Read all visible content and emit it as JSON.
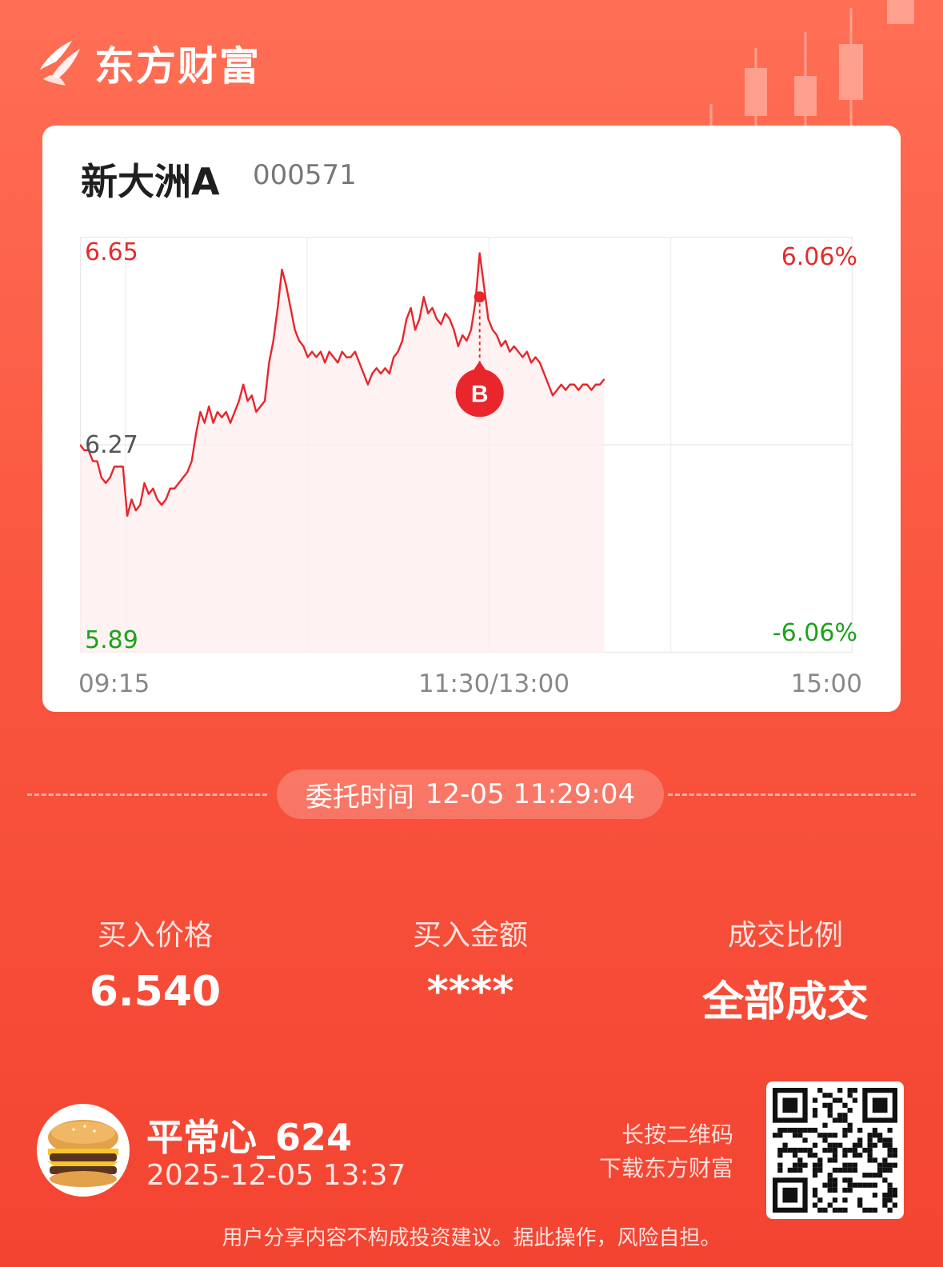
{
  "brand": {
    "name": "东方财富",
    "logo_icon": "eastmoney-logo-icon"
  },
  "stock": {
    "name": "新大洲A",
    "code": "000571"
  },
  "chart_data": {
    "type": "line",
    "title": "",
    "price_labels": {
      "high": "6.65",
      "prev_close": "6.27",
      "low": "5.89"
    },
    "pct_labels": {
      "high": "6.06%",
      "low": "-6.06%"
    },
    "time_labels": {
      "open": "09:15",
      "mid": "11:30/13:00",
      "close": "15:00"
    },
    "ylim": [
      5.89,
      6.65
    ],
    "prev_close": 6.27,
    "line_color": "#e8262b",
    "up_color": "#e22c2c",
    "down_color": "#1aa21a",
    "series": [
      {
        "values": [
          6.27,
          6.26,
          6.26,
          6.24,
          6.24,
          6.21,
          6.2,
          6.21,
          6.23,
          6.23,
          6.23,
          6.14,
          6.17,
          6.15,
          6.16,
          6.2,
          6.18,
          6.19,
          6.17,
          6.16,
          6.17,
          6.19,
          6.19,
          6.2,
          6.21,
          6.22,
          6.24,
          6.29,
          6.33,
          6.31,
          6.34,
          6.31,
          6.33,
          6.32,
          6.33,
          6.31,
          6.33,
          6.35,
          6.38,
          6.35,
          6.36,
          6.33,
          6.34,
          6.35,
          6.42,
          6.46,
          6.52,
          6.59,
          6.56,
          6.52,
          6.48,
          6.46,
          6.45,
          6.43,
          6.44,
          6.43,
          6.44,
          6.42,
          6.44,
          6.43,
          6.42,
          6.44,
          6.43,
          6.43,
          6.44,
          6.42,
          6.4,
          6.38,
          6.4,
          6.41,
          6.4,
          6.41,
          6.4,
          6.43,
          6.44,
          6.46,
          6.5,
          6.52,
          6.48,
          6.5,
          6.54,
          6.51,
          6.52,
          6.5,
          6.49,
          6.51,
          6.5,
          6.48,
          6.45,
          6.47,
          6.46,
          6.48,
          6.53,
          6.62,
          6.56,
          6.5,
          6.48,
          6.47,
          6.45,
          6.46,
          6.44,
          6.45,
          6.44,
          6.43,
          6.44,
          6.42,
          6.43,
          6.42,
          6.4,
          6.38,
          6.36,
          6.37,
          6.38,
          6.37,
          6.38,
          6.38,
          6.37,
          6.38,
          6.38,
          6.37,
          6.38,
          6.38,
          6.39
        ]
      }
    ],
    "buy_marker": {
      "label": "B",
      "index": 93,
      "price": 6.54
    }
  },
  "order": {
    "label": "委托时间",
    "datetime": "12-05 11:29:04"
  },
  "stats": [
    {
      "label": "买入价格",
      "value": "6.540"
    },
    {
      "label": "买入金额",
      "value": "****"
    },
    {
      "label": "成交比例",
      "value": "全部成交"
    }
  ],
  "user": {
    "name": "平常心_624",
    "share_time": "2025-12-05 13:37",
    "avatar_icon": "burger-avatar-icon"
  },
  "qr": {
    "hint_line1": "长按二维码",
    "hint_line2": "下载东方财富",
    "icon": "qr-code-icon"
  },
  "disclaimer": "用户分享内容不构成投资建议。据此操作，风险自担。"
}
